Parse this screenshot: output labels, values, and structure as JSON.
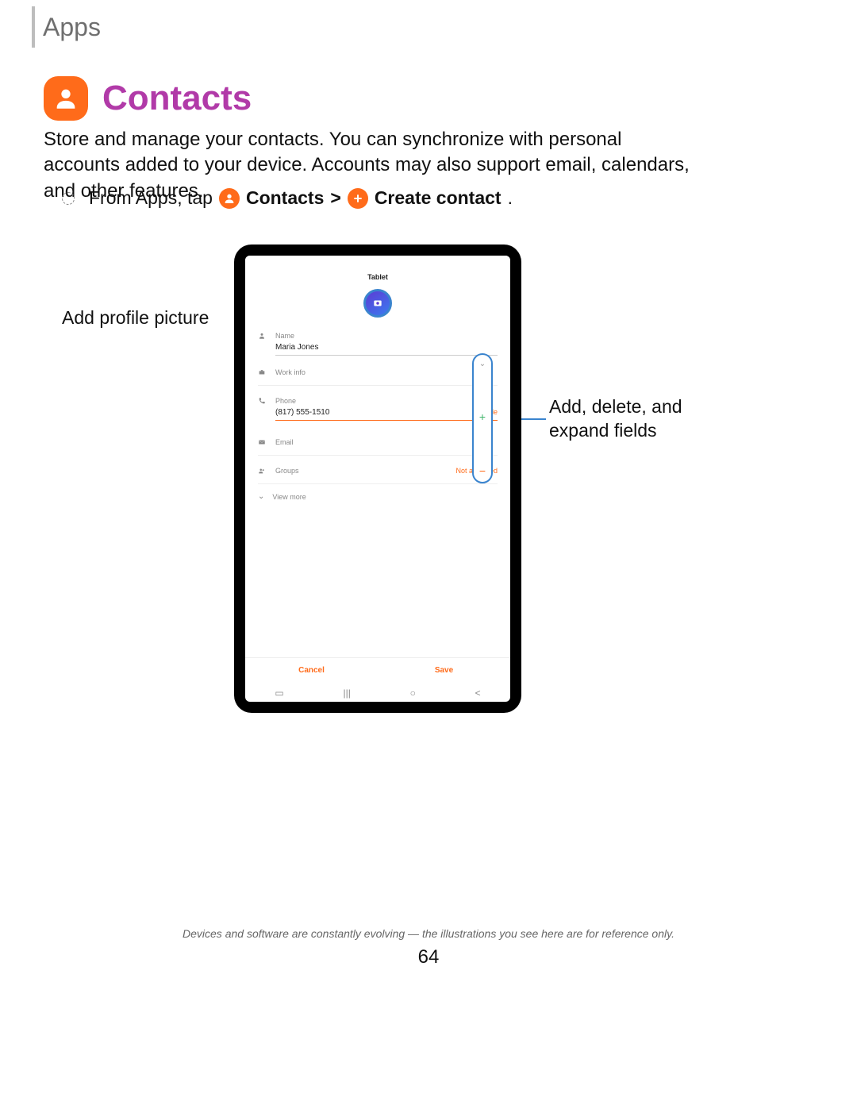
{
  "breadcrumb": "Apps",
  "heading": "Contacts",
  "intro": "Store and manage your contacts. You can synchronize with personal accounts added to your device. Accounts may also support email, calendars, and other features.",
  "step": {
    "prefix": "From Apps, tap ",
    "contacts": "Contacts",
    "chevron": ">",
    "create": "Create contact",
    "period": "."
  },
  "callouts": {
    "left": "Add profile picture",
    "right_line1": "Add, delete, and",
    "right_line2": "expand fields"
  },
  "screen": {
    "title": "Tablet",
    "fields": {
      "name_label": "Name",
      "name_value": "Maria Jones",
      "work_label": "Work info",
      "phone_label": "Phone",
      "phone_value": "(817) 555-1510",
      "phone_type": "Mobile",
      "email_label": "Email",
      "groups_label": "Groups",
      "groups_value": "Not assigned",
      "viewmore": "View more"
    },
    "actions": {
      "cancel": "Cancel",
      "save": "Save"
    },
    "pill": {
      "chev": "⌄",
      "plus": "+",
      "minus": "−"
    }
  },
  "footnote": "Devices and software are constantly evolving — the illustrations you see here are for reference only.",
  "pagenum": "64"
}
